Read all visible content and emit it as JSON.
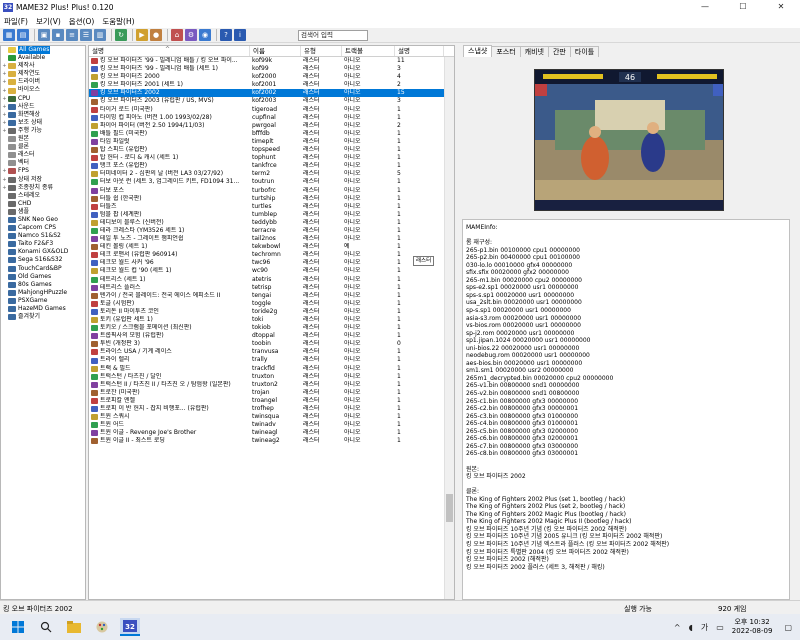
{
  "window": {
    "title": "MAME32 Plus! Plus! 0.120",
    "app_icon": "32",
    "min": "—",
    "max": "☐",
    "close": "✕"
  },
  "menu": [
    "파일(F)",
    "보기(V)",
    "옵션(O)",
    "도움말(H)"
  ],
  "search": {
    "value": "검색어 입력"
  },
  "tree": [
    {
      "label": "All Games",
      "color": "#e8c840",
      "exp": "",
      "selected": true
    },
    {
      "label": "Available",
      "color": "#2a9a3a",
      "exp": ""
    },
    {
      "label": "제작사",
      "color": "#d8b040",
      "exp": "+"
    },
    {
      "label": "제작연도",
      "color": "#d8b040",
      "exp": "+"
    },
    {
      "label": "드라이버",
      "color": "#d8b040",
      "exp": "+"
    },
    {
      "label": "바이오스",
      "color": "#d8b040",
      "exp": "+"
    },
    {
      "label": "CPU",
      "color": "#3a6a3a",
      "exp": "+"
    },
    {
      "label": "사운드",
      "color": "#3a6aa0",
      "exp": "+"
    },
    {
      "label": "화면해상",
      "color": "#3a6aa0",
      "exp": "+"
    },
    {
      "label": "보조 상태",
      "color": "#3a6aa0",
      "exp": "+"
    },
    {
      "label": "주행 가능",
      "color": "#6a6a6a",
      "exp": "+"
    },
    {
      "label": "원본",
      "color": "#909090",
      "exp": ""
    },
    {
      "label": "클론",
      "color": "#909090",
      "exp": ""
    },
    {
      "label": "래스터",
      "color": "#909090",
      "exp": ""
    },
    {
      "label": "벡터",
      "color": "#909090",
      "exp": ""
    },
    {
      "label": "FPS",
      "color": "#b05050",
      "exp": "+"
    },
    {
      "label": "상태 저장",
      "color": "#6a6a6a",
      "exp": "+"
    },
    {
      "label": "조종장치 종류",
      "color": "#6a6a6a",
      "exp": "+"
    },
    {
      "label": "스테레오",
      "color": "#6a6a6a",
      "exp": ""
    },
    {
      "label": "CHD",
      "color": "#6a6a6a",
      "exp": ""
    },
    {
      "label": "샘플",
      "color": "#6a6a6a",
      "exp": ""
    },
    {
      "label": "SNK Neo Geo",
      "color": "#3a6aa0",
      "exp": ""
    },
    {
      "label": "Capcom CPS",
      "color": "#3a6aa0",
      "exp": ""
    },
    {
      "label": "Namco S1&S2",
      "color": "#3a6aa0",
      "exp": ""
    },
    {
      "label": "Taito F2&F3",
      "color": "#3a6aa0",
      "exp": ""
    },
    {
      "label": "Konami GX&OLD",
      "color": "#3a6aa0",
      "exp": ""
    },
    {
      "label": "Sega S16&S32",
      "color": "#3a6aa0",
      "exp": ""
    },
    {
      "label": "TouchCard&BP",
      "color": "#3a6aa0",
      "exp": ""
    },
    {
      "label": "Old Games",
      "color": "#3a6aa0",
      "exp": ""
    },
    {
      "label": "80s Games",
      "color": "#3a6aa0",
      "exp": ""
    },
    {
      "label": "MahjongHPuzzle",
      "color": "#3a6aa0",
      "exp": ""
    },
    {
      "label": "PSXGame",
      "color": "#3a6aa0",
      "exp": ""
    },
    {
      "label": "HazeMD Games",
      "color": "#3a6aa0",
      "exp": ""
    },
    {
      "label": "즐겨찾기",
      "color": "#3a6aa0",
      "exp": ""
    }
  ],
  "list": {
    "headers": [
      "설명",
      "이름",
      "유형",
      "트랙볼",
      "설명"
    ],
    "rows": [
      {
        "desc": "킹 오브 파이터즈 '99 - 밀레니엄 배틀 / 킹 오브 파이...",
        "name": "kof99k",
        "type": "래스터",
        "tb": "아니오",
        "n": "11"
      },
      {
        "desc": "킹 오브 파이터즈 '99 - 밀레니엄 배틀 (세트 1)",
        "name": "kof99",
        "type": "래스터",
        "tb": "아니오",
        "n": "3"
      },
      {
        "desc": "킹 오브 파이터즈 2000",
        "name": "kof2000",
        "type": "래스터",
        "tb": "아니오",
        "n": "4"
      },
      {
        "desc": "킹 오브 파이터즈 2001 (세트 1)",
        "name": "kof2001",
        "type": "래스터",
        "tb": "아니오",
        "n": "2"
      },
      {
        "desc": "킹 오브 파이터즈 2002",
        "name": "kof2002",
        "type": "래스터",
        "tb": "아니오",
        "n": "15",
        "selected": true
      },
      {
        "desc": "킹 오브 파이터즈 2003 (유럽판 / US, MVS)",
        "name": "kof2003",
        "type": "래스터",
        "tb": "아니오",
        "n": "3"
      },
      {
        "desc": "타이거 로드 (미국판)",
        "name": "tigeroad",
        "type": "래스터",
        "tb": "아니오",
        "n": "1"
      },
      {
        "desc": "타이밍 컵 피아노 (버전 1.00 1993/02/28)",
        "name": "cupfinal",
        "type": "래스터",
        "tb": "아니오",
        "n": "1"
      },
      {
        "desc": "파이어 파이터 (버전 2.50 1994/11/03)",
        "name": "pwrgoal",
        "type": "래스터",
        "tb": "아니오",
        "n": "2"
      },
      {
        "desc": "배틀 필드 (미국판)",
        "name": "bfffdb",
        "type": "래스터",
        "tb": "아니오",
        "n": "1"
      },
      {
        "desc": "타임 파일럿",
        "name": "timeplt",
        "type": "래스터",
        "tb": "아니오",
        "n": "1"
      },
      {
        "desc": "탑 스피드 (유럽판)",
        "name": "topspeed",
        "type": "래스터",
        "tb": "아니오",
        "n": "1"
      },
      {
        "desc": "탑 헌터 - 로디 & 캐시 (세트 1)",
        "name": "tophunt",
        "type": "래스터",
        "tb": "아니오",
        "n": "1"
      },
      {
        "desc": "탱크 포스 (유럽판)",
        "name": "tankfrce",
        "type": "래스터",
        "tb": "아니오",
        "n": "1"
      },
      {
        "desc": "터미네이터 2 - 심판의 날 (버전 LA3 03/27/92)",
        "name": "term2",
        "type": "래스터",
        "tb": "아니오",
        "n": "5"
      },
      {
        "desc": "터보 아웃 런 (세트 3, 업그레이드 키트, FD1094 31...",
        "name": "toutrun",
        "type": "래스터",
        "tb": "아니오",
        "n": "1"
      },
      {
        "desc": "터보 포스",
        "name": "turbofrc",
        "type": "래스터",
        "tb": "아니오",
        "n": "1"
      },
      {
        "desc": "터틀 쉽 (한국판)",
        "name": "turtship",
        "type": "래스터",
        "tb": "아니오",
        "n": "1"
      },
      {
        "desc": "터틀즈",
        "name": "turtles",
        "type": "래스터",
        "tb": "아니오",
        "n": "1"
      },
      {
        "desc": "텀블 팝 (세계판)",
        "name": "tumblep",
        "type": "래스터",
        "tb": "아니오",
        "n": "1"
      },
      {
        "desc": "테디보이 블루스 (신버전)",
        "name": "teddybb",
        "type": "래스터",
        "tb": "아니오",
        "n": "1"
      },
      {
        "desc": "테라 크레스타 (YM3526 세트 1)",
        "name": "terracre",
        "type": "래스터",
        "tb": "아니오",
        "n": "1"
      },
      {
        "desc": "테일 투 노즈 - 그레이트 챔피언쉽",
        "name": "tail2nos",
        "type": "래스터",
        "tb": "아니오",
        "n": "1"
      },
      {
        "desc": "테킨 볼링 (세트 1)",
        "name": "tekwbowl",
        "type": "래스터",
        "tb": "예",
        "n": "1"
      },
      {
        "desc": "테크 로맨서 (유럽판 960914)",
        "name": "techromn",
        "type": "래스터",
        "tb": "아니오",
        "n": "1"
      },
      {
        "desc": "테크모 월드 사커 '96",
        "name": "twc96",
        "type": "래스터",
        "tb": "아니오",
        "n": "1"
      },
      {
        "desc": "테크모 월드 컵 '90 (세트 1)",
        "name": "wc90",
        "type": "래스터",
        "tb": "아니오",
        "n": "1"
      },
      {
        "desc": "테트리스 (세트 1)",
        "name": "atetris",
        "type": "래스터",
        "tb": "아니오",
        "n": "1"
      },
      {
        "desc": "테트리스 플러스",
        "name": "tetrisp",
        "type": "래스터",
        "tb": "아니오",
        "n": "1"
      },
      {
        "desc": "텐가이 / 전국 블레이드: 전국 에이스 에피소드 II",
        "name": "tengai",
        "type": "래스터",
        "tb": "아니오",
        "n": "1"
      },
      {
        "desc": "토글 (시험판)",
        "name": "toggle",
        "type": "래스터",
        "tb": "아니오",
        "n": "1"
      },
      {
        "desc": "토리돈 II 마이투츠 코인",
        "name": "toride2g",
        "type": "래스터",
        "tb": "아니오",
        "n": "1"
      },
      {
        "desc": "토키 (유럽판 세트 1)",
        "name": "toki",
        "type": "래스터",
        "tb": "아니오",
        "n": "1"
      },
      {
        "desc": "토키오 / 스크램블 포메이션 (최신판)",
        "name": "tokiob",
        "type": "래스터",
        "tb": "아니오",
        "n": "1"
      },
      {
        "desc": "트롭픽사의 모험 (유럽판)",
        "name": "dtoppal",
        "type": "래스터",
        "tb": "아니오",
        "n": "1"
      },
      {
        "desc": "투빈 (개정판 3)",
        "name": "toobin",
        "type": "래스터",
        "tb": "아니오",
        "n": "0"
      },
      {
        "desc": "트라이스 USA / 기계 레이스",
        "name": "tranvusa",
        "type": "래스터",
        "tb": "아니오",
        "n": "1"
      },
      {
        "desc": "트라이 렐리",
        "name": "trally",
        "type": "래스터",
        "tb": "아니오",
        "n": "1"
      },
      {
        "desc": "트랙 & 필드",
        "name": "trackfld",
        "type": "래스터",
        "tb": "아니오",
        "n": "1"
      },
      {
        "desc": "트럭스턴 / 타츠진 / 달인",
        "name": "truxton",
        "type": "래스터",
        "tb": "아니오",
        "n": "1"
      },
      {
        "desc": "트럭스턴 II / 타츠진 II / 타츠진 오 / 탐험왕 (일본판)",
        "name": "truxton2",
        "type": "래스터",
        "tb": "아니오",
        "n": "1"
      },
      {
        "desc": "트로잔 (미국판)",
        "name": "trojan",
        "type": "래스터",
        "tb": "아니오",
        "n": "1"
      },
      {
        "desc": "트로피칼 엔젤",
        "name": "troangel",
        "type": "래스터",
        "tb": "아니오",
        "n": "1"
      },
      {
        "desc": "트로피 이 반 헌지 - 잡지 비행포... (유럽판)",
        "name": "trofhep",
        "type": "래스터",
        "tb": "아니오",
        "n": "1"
      },
      {
        "desc": "트윈 스쿼시",
        "name": "twinsqua",
        "type": "래스터",
        "tb": "아니오",
        "n": "1"
      },
      {
        "desc": "트윈 어드",
        "name": "twinadv",
        "type": "래스터",
        "tb": "아니오",
        "n": "1"
      },
      {
        "desc": "트윈 이글 - Revenge Joe's Brother",
        "name": "twineagl",
        "type": "래스터",
        "tb": "아니오",
        "n": "1"
      },
      {
        "desc": "트윈 이글 II - 최스트 로딩",
        "name": "twineag2",
        "type": "래스터",
        "tb": "아니오",
        "n": "1"
      }
    ],
    "tooltip": "래스터"
  },
  "tabs": [
    "스냅샷",
    "포스터",
    "캐비넷",
    "간판",
    "타이틀"
  ],
  "snapshot": {
    "p1": "1P",
    "p2": "2P",
    "timer": "46"
  },
  "info": [
    "MAMEInfo:",
    "",
    "롬 재구성:",
    "265-p1.bin 00100000 cpu1 00000000",
    "265-p2.bin 00400000 cpu1 00100000",
    "030-lo.lo 00010000 gfx4 00000000",
    "sfix.sfix 00020000 gfx2 00000000",
    "265-m1.bin 00020000 cpu2 00000000",
    "sps-e2.sp1 00020000 usr1 00000000",
    "sps-s.sp1 00020000 usr1 00000000",
    "usa_2slt.bin 00020000 usr1 00000000",
    "sp-s.sp1 00020000 usr1 00000000",
    "asia-s3.rom 00020000 usr1 00000000",
    "vs-bios.rom 00020000 usr1 00000000",
    "sp-j2.rom 00020000 usr1 00000000",
    "sp1.jipan.1024 00020000 usr1 00000000",
    "uni-bios.22 00020000 usr1 00000000",
    "neodebug.rom 00020000 usr1 00000000",
    "aes-bios.bin 00020000 usr1 00000000",
    "sm1.sm1 00020000 usr2 00000000",
    "265m1_decrypted.bin 00020000 cpu2 00000000",
    "265-v1.bin 00800000 snd1 00000000",
    "265-v2.bin 00800000 snd1 00800000",
    "265-c1.bin 00800000 gfx3 00000000",
    "265-c2.bin 00800000 gfx3 00000001",
    "265-c3.bin 00800000 gfx3 01000000",
    "265-c4.bin 00800000 gfx3 01000001",
    "265-c5.bin 00800000 gfx3 02000000",
    "265-c6.bin 00800000 gfx3 02000001",
    "265-c7.bin 00800000 gfx3 03000000",
    "265-c8.bin 00800000 gfx3 03000001",
    "",
    "원본:",
    "킹 오브 파이터즈 2002",
    "",
    "클론:",
    "The King of Fighters 2002 Plus (set 1, bootleg / hack)",
    "The King of Fighters 2002 Plus (set 2, bootleg / hack)",
    "The King of Fighters 2002 Magic Plus (bootleg / hack)",
    "The King of Fighters 2002 Magic Plus II (bootleg / hack)",
    "킹 오브 파이터즈 10주년 기념 (킹 오브 파이터즈 2002 해적판)",
    "킹 오브 파이터즈 10주년 기념 2005 유니크 (킹 오브 파이터즈 2002 해적판)",
    "킹 오브 파이터즈 10주년 기념 엑스트라 플러스 (킹 오브 파이터즈 2002 해적판)",
    "킹 오브 파이터즈 특별판 2004 (킹 오브 파이터즈 2002 해적판)",
    "킹 오브 파이터즈 2002 (해적판)",
    "킹 오브 파이터즈 2002 플러스 (세트 3, 해적판 / 해킹)"
  ],
  "status": {
    "left": "킹 오브 파이터즈 2002",
    "mid": "실행 가능",
    "right": "920 게임"
  },
  "taskbar": {
    "ime1": "가",
    "time": "오후 10:32",
    "date": "2022-08-09"
  }
}
